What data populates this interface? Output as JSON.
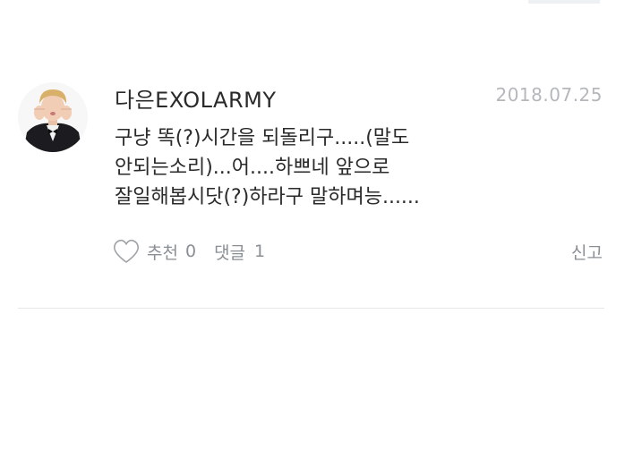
{
  "comment": {
    "username": "다은EXOLARMY",
    "date": "2018.07.25",
    "text": "구냥 똑(?)시간을 되돌리구.....(말도\n안되는소리)...어....하쁘네 앞으로\n잘일해봅시닷(?)하라구 말하며능......",
    "like_label": "추천",
    "like_count": "0",
    "comment_label": "댓글",
    "comment_count": "1",
    "report_label": "신고",
    "like_icon": "heart-outline-icon",
    "avatar": "profile-photo"
  },
  "colors": {
    "text": "#2a2a2a",
    "muted": "#8a8f95",
    "date": "#b4b8bc",
    "divider": "#e4e6e8"
  }
}
